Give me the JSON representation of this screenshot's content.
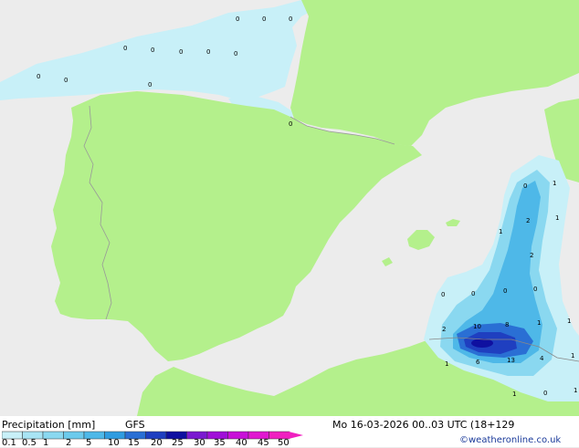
{
  "title": "Precipitation [mm]",
  "model": "GFS",
  "datetime": "Mo 16-03-2026 00..03 UTC (18+129",
  "credit": "©weatheronline.co.uk",
  "legend": {
    "ticks": [
      "0.1",
      "0.5",
      "1",
      "2",
      "5",
      "10",
      "15",
      "20",
      "25",
      "30",
      "35",
      "40",
      "45",
      "50"
    ],
    "colors": [
      "#c8f0f8",
      "#a8e4f4",
      "#8ad8f0",
      "#6ccaec",
      "#4eb8e8",
      "#2f9ce0",
      "#2a6fd4",
      "#1f3fc0",
      "#0f10a0",
      "#7a1ad0",
      "#a010d8",
      "#c810d8",
      "#e018d0",
      "#f020c0"
    ]
  },
  "colors": {
    "land": "#b4f08c",
    "sea": "#ececec",
    "precip_light": "#c8f0f8",
    "precip_moderate": "#6ccaec",
    "precip_heavy": "#1f3fc0"
  },
  "map_values": [
    "0",
    "0",
    "0",
    "0",
    "0",
    "0",
    "0",
    "0",
    "0",
    "0",
    "0",
    "0",
    "0",
    "1",
    "2",
    "1",
    "1",
    "2",
    "0",
    "0",
    "0",
    "0",
    "1",
    "1",
    "2",
    "10",
    "8",
    "1",
    "6",
    "13",
    "4",
    "1",
    "1",
    "0",
    "1"
  ]
}
